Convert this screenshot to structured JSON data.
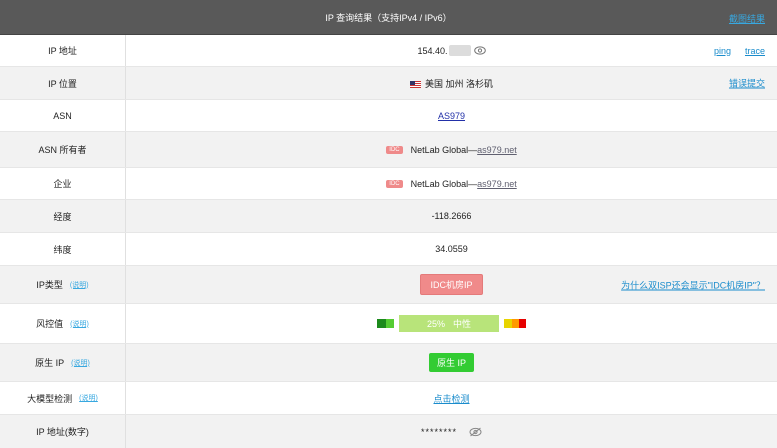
{
  "header": {
    "title": "IP 查询结果（支持IPv4 / IPv6）",
    "screenshot_link": "截图结果"
  },
  "rows": {
    "ip": {
      "label": "IP 地址",
      "value_prefix": "154.40.",
      "links": [
        "ping",
        "trace"
      ]
    },
    "location": {
      "label": "IP 位置",
      "value": "美国 加州 洛杉矶",
      "link": "错误提交"
    },
    "asn": {
      "label": "ASN",
      "value": "AS979"
    },
    "asn_owner": {
      "label": "ASN 所有者",
      "tag": "IDC",
      "name": "NetLab Global—",
      "domain": "as979.net"
    },
    "company": {
      "label": "企业",
      "tag": "IDC",
      "name": "NetLab Global—",
      "domain": "as979.net"
    },
    "longitude": {
      "label": "经度",
      "value": "-118.2666"
    },
    "latitude": {
      "label": "纬度",
      "value": "34.0559"
    },
    "ip_type": {
      "label": "IP类型",
      "note": "(说明)",
      "value": "IDC机房IP",
      "link": "为什么双ISP还会显示\"IDC机房IP\"？"
    },
    "risk": {
      "label": "风控值",
      "note": "(说明)",
      "percent": "25%",
      "level": "中性",
      "value": 25
    },
    "native": {
      "label": "原生 IP",
      "note": "(说明)",
      "value": "原生 IP"
    },
    "ai_check": {
      "label": "大模型检测",
      "note": "(说明)",
      "value": "点击检测"
    },
    "ip_numeric": {
      "label": "IP 地址(数字)",
      "value": "********"
    }
  },
  "colors": {
    "header_bg": "#595959",
    "link_blue": "#38a8e0",
    "idc_red": "#f08a8a",
    "risk_green": "#b8e47a",
    "native_green": "#33cc33"
  }
}
